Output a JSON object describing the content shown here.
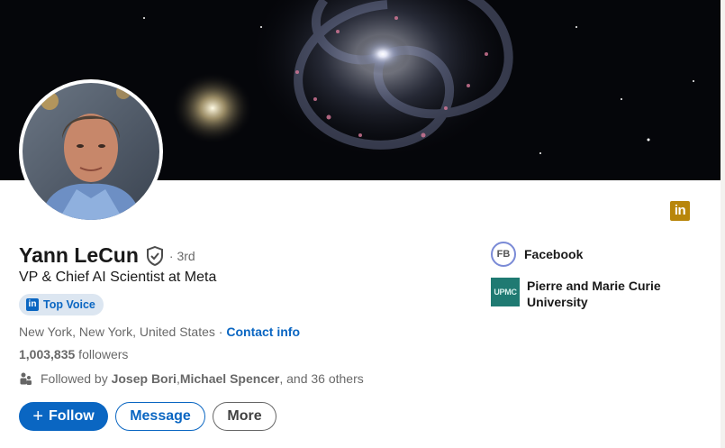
{
  "profile": {
    "name": "Yann LeCun",
    "degree": "· 3rd",
    "headline": "VP & Chief AI Scientist at Meta",
    "badge_label": "Top Voice",
    "location": "New York, New York, United States",
    "location_separator": " · ",
    "contact_label": "Contact info",
    "followers_count": "1,003,835",
    "followers_label": " followers",
    "followed_by_prefix": "Followed by ",
    "followed_by_person1": "Josep Bori",
    "followed_by_sep": ", ",
    "followed_by_person2": "Michael Spencer",
    "followed_by_suffix": ", and 36 others"
  },
  "actions": {
    "follow_label": "Follow",
    "message_label": "Message",
    "more_label": "More"
  },
  "organizations": [
    {
      "logo_text": "FB",
      "name": "Facebook"
    },
    {
      "logo_text": "UPMC",
      "name": "Pierre and Marie Curie University"
    }
  ],
  "icons": {
    "linkedin_badge": "in",
    "topvoice_icon": "in"
  },
  "colors": {
    "accent": "#0a66c2",
    "badge_bg": "#dce6f1",
    "linkedin_gold": "#b8860b",
    "upmc_teal": "#1f7a72"
  }
}
